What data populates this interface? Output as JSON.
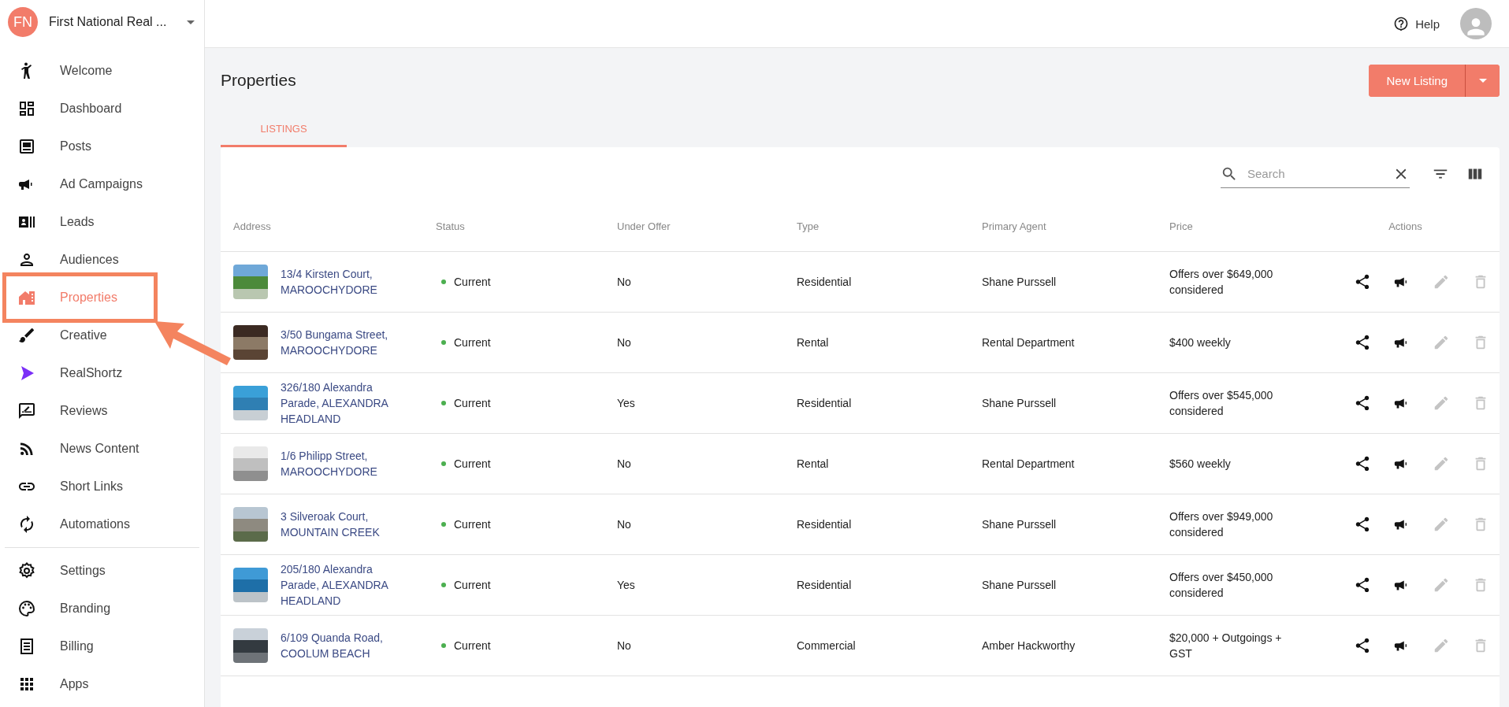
{
  "account": {
    "initials": "FN",
    "name": "First National Real ..."
  },
  "sidebar": {
    "groups": [
      {
        "items": [
          {
            "label": "Welcome",
            "selected": false
          },
          {
            "label": "Dashboard",
            "selected": false
          },
          {
            "label": "Posts",
            "selected": false
          },
          {
            "label": "Ad Campaigns",
            "selected": false
          },
          {
            "label": "Leads",
            "selected": false
          },
          {
            "label": "Audiences",
            "selected": false
          },
          {
            "label": "Properties",
            "selected": true
          },
          {
            "label": "Creative",
            "selected": false
          },
          {
            "label": "RealShortz",
            "selected": false
          },
          {
            "label": "Reviews",
            "selected": false
          },
          {
            "label": "News Content",
            "selected": false
          },
          {
            "label": "Short Links",
            "selected": false
          },
          {
            "label": "Automations",
            "selected": false
          }
        ]
      },
      {
        "items": [
          {
            "label": "Settings",
            "selected": false
          },
          {
            "label": "Branding",
            "selected": false
          },
          {
            "label": "Billing",
            "selected": false
          },
          {
            "label": "Apps",
            "selected": false
          }
        ]
      }
    ]
  },
  "header": {
    "help": "Help"
  },
  "page": {
    "title": "Properties",
    "new_button": "New Listing"
  },
  "tabs": [
    {
      "label": "LISTINGS",
      "selected": true
    }
  ],
  "search": {
    "placeholder": "Search"
  },
  "table": {
    "columns": [
      "Address",
      "Status",
      "Under Offer",
      "Type",
      "Primary Agent",
      "Price",
      "Actions"
    ],
    "rows": [
      {
        "address": "13/4 Kirsten Court, MAROOCHYDORE",
        "status": "Current",
        "under_offer": "No",
        "type": "Residential",
        "agent": "Shane Purssell",
        "price": "Offers over $649,000 considered",
        "edit_disabled": true,
        "delete_disabled": true
      },
      {
        "address": "3/50 Bungama Street, MAROOCHYDORE",
        "status": "Current",
        "under_offer": "No",
        "type": "Rental",
        "agent": "Rental Department",
        "price": "$400 weekly",
        "edit_disabled": true,
        "delete_disabled": true
      },
      {
        "address": "326/180 Alexandra Parade, ALEXANDRA HEADLAND",
        "status": "Current",
        "under_offer": "Yes",
        "type": "Residential",
        "agent": "Shane Purssell",
        "price": "Offers over $545,000 considered",
        "edit_disabled": true,
        "delete_disabled": true
      },
      {
        "address": "1/6 Philipp Street, MAROOCHYDORE",
        "status": "Current",
        "under_offer": "No",
        "type": "Rental",
        "agent": "Rental Department",
        "price": "$560 weekly",
        "edit_disabled": true,
        "delete_disabled": true
      },
      {
        "address": "3 Silveroak Court, MOUNTAIN CREEK",
        "status": "Current",
        "under_offer": "No",
        "type": "Residential",
        "agent": "Shane Purssell",
        "price": "Offers over $949,000 considered",
        "edit_disabled": true,
        "delete_disabled": true
      },
      {
        "address": "205/180 Alexandra Parade, ALEXANDRA HEADLAND",
        "status": "Current",
        "under_offer": "Yes",
        "type": "Residential",
        "agent": "Shane Purssell",
        "price": "Offers over $450,000 considered",
        "edit_disabled": true,
        "delete_disabled": true
      },
      {
        "address": "6/109 Quanda Road, COOLUM BEACH",
        "status": "Current",
        "under_offer": "No",
        "type": "Commercial",
        "agent": "Amber Hackworthy",
        "price": "$20,000 + Outgoings + GST",
        "edit_disabled": true,
        "delete_disabled": true
      }
    ]
  }
}
